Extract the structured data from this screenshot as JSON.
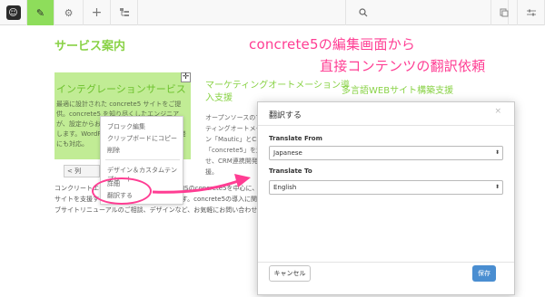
{
  "toolbar": {
    "logo_icon": "concrete5-logo-icon",
    "edit_icon": "pencil-icon",
    "settings_icon": "gear-icon",
    "add_icon": "plus-icon",
    "sitemap_icon": "sitemap-icon",
    "search_icon": "search-icon",
    "pages_icon": "pages-icon",
    "dashboard_icon": "sliders-icon"
  },
  "page": {
    "title": "サービス案内",
    "overlay_line1": "concrete5の編集画面から",
    "overlay_line2": "直接コンテンツの翻訳依頼",
    "col1": {
      "heading": "インテグレーションサービス",
      "body": "最適に設計された concrete5 サイトをご提供。concrete5 を知り尽くしたエンジニアが、設定からお客さまの課題をフルサポートします。WordPress 等のシステムからの開発にも対応。"
    },
    "col2": {
      "heading": "マーケティングオートメーション導入支援",
      "body": "オープンソースのマーケティングオートメーション「Mautic」とCMS「concrete5」を連携させ、CRM連携開発を支援。"
    },
    "col3": {
      "heading": "多言語WEBサイト構築支援"
    },
    "section_link": "< 列",
    "bottom_text": "コンクリートエイトでは、オープンソースCMSのconcrete5を中心に、企業様のウェブサイトを支援する企業様をサポートしています。concrete5の導入に関するご質問、ウェブサイトリニューアルのご相談、デザインなど、お気軽にお問い合わせください。"
  },
  "context_menu": {
    "items": [
      "ブロック編集",
      "クリップボードにコピー",
      "削除",
      "デザイン＆カスタムテンプレート",
      "詳細",
      "翻訳する"
    ]
  },
  "dialog": {
    "title": "翻訳する",
    "close": "×",
    "from_label": "Translate From",
    "from_value": "Japanese",
    "to_label": "Translate To",
    "to_value": "English",
    "select_arrow": "⬍",
    "cancel_label": "キャンセル",
    "save_label": "保存"
  },
  "colors": {
    "accent_green": "#89d246",
    "highlight_pink": "#ff3d93",
    "save_blue": "#4a8ed1"
  }
}
